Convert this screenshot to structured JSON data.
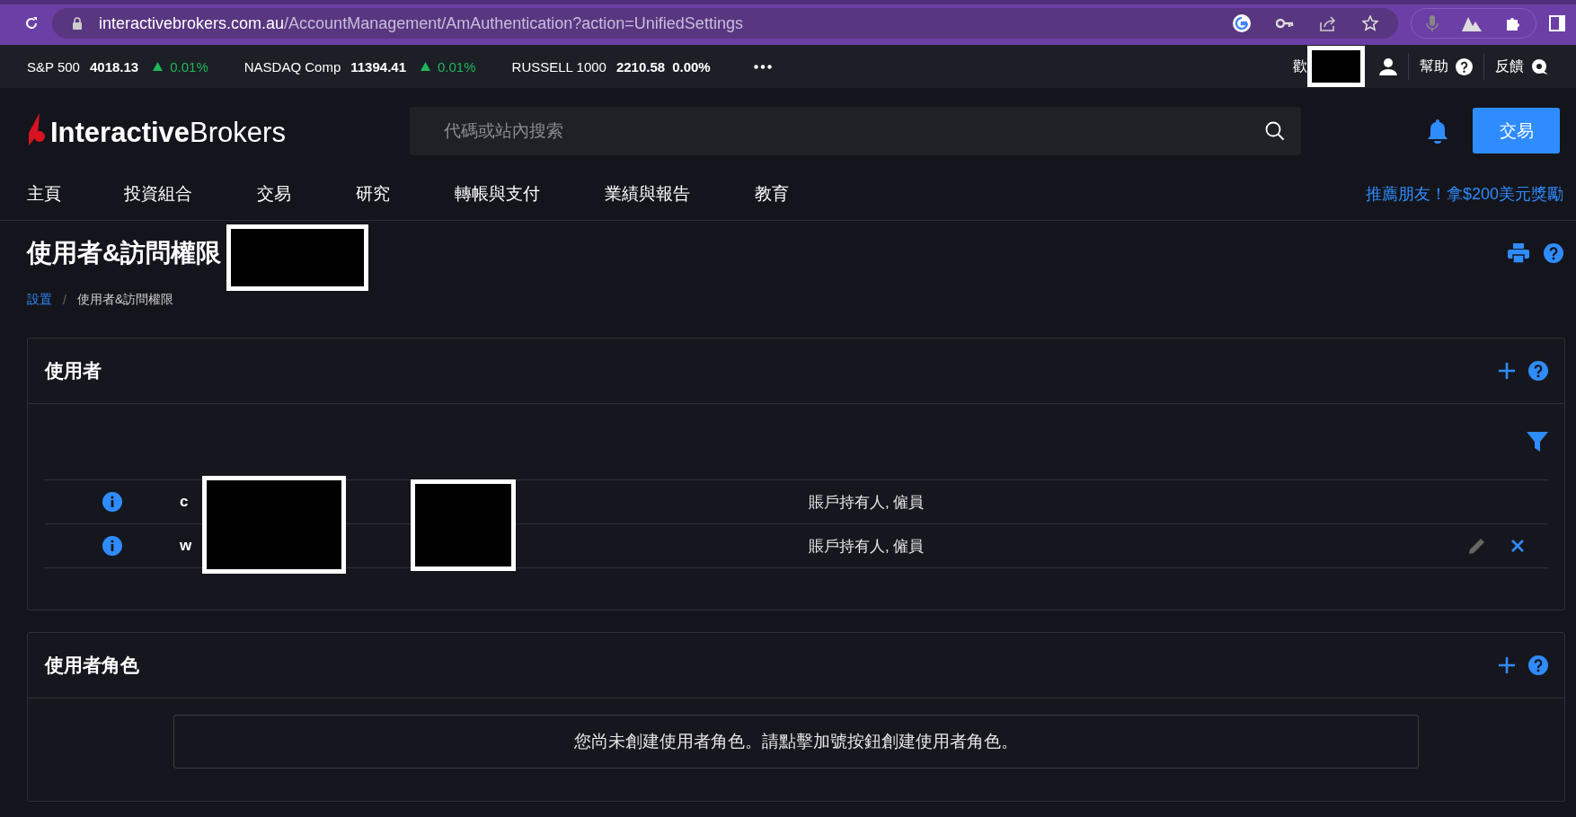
{
  "browser": {
    "url_host": "interactivebrokers.com.au",
    "url_path": "/AccountManagement/AmAuthentication?action=UnifiedSettings"
  },
  "ticker": [
    {
      "name": "S&P 500",
      "value": "4018.13",
      "change": "0.01%",
      "rising": true
    },
    {
      "name": "NASDAQ Comp",
      "value": "11394.41",
      "change": "0.01%",
      "rising": true
    },
    {
      "name": "RUSSELL 1000",
      "value": "2210.58",
      "change": "0.00%",
      "rising": false
    }
  ],
  "account_bar": {
    "welcome": "歡",
    "help": "幫助",
    "feedback": "反饋"
  },
  "header": {
    "logo_bold": "Interactive",
    "logo_light": "Brokers",
    "search": {
      "placeholder": "代碼或站內搜索"
    },
    "trade_button": "交易"
  },
  "nav": {
    "items": [
      {
        "label": "主頁"
      },
      {
        "label": "投資組合"
      },
      {
        "label": "交易"
      },
      {
        "label": "研究"
      },
      {
        "label": "轉帳與支付"
      },
      {
        "label": "業績與報告"
      },
      {
        "label": "教育"
      }
    ],
    "promo": "推薦朋友！拿$200美元獎勵"
  },
  "page": {
    "title": "使用者&訪問權限",
    "breadcrumb": [
      "設置",
      "使用者&訪問權限"
    ],
    "breadcrumb_separator": "/"
  },
  "users": {
    "title": "使用者",
    "rows": [
      {
        "name": "c",
        "roles": "賬戶持有人, 僱員",
        "editable": false
      },
      {
        "name": "w",
        "roles": "賬戶持有人, 僱員",
        "editable": true
      }
    ]
  },
  "user_roles": {
    "title": "使用者角色",
    "empty_message": "您尚未創建使用者角色。請點擊加號按鈕創建使用者角色。"
  }
}
